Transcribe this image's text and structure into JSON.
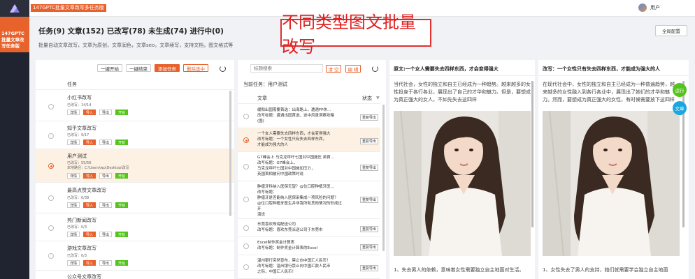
{
  "app": {
    "title": "147GPTC批量文章改写多任务版",
    "user_name": "用户"
  },
  "sidebar": {
    "items": [
      {
        "label": "147GPTC批量文章改写任务版"
      }
    ]
  },
  "summary": {
    "stats_line": "任务(9) 文章(152) 已改写(78) 未生成(74) 进行中(0)",
    "subtitle": "批量自动文章改写，文章为原创，文章润色，文章seo，文章续写，支持文档，图文格式等"
  },
  "banner": "不同类型图文批量改写",
  "global_config_label": "全局配置",
  "tasks_panel": {
    "buttons": {
      "start_all": "一键开始",
      "stop_all": "一键结束",
      "add_task": "添加任务",
      "delete_selected": "删除选中"
    },
    "column_header": "任务",
    "import_label": "导入",
    "export_label": "导出",
    "detail_label": "详情",
    "start_label": "开始",
    "rows": [
      {
        "name": "小红书改写",
        "done": "已改写：14/14"
      },
      {
        "name": "知乎文章改写",
        "done": "已改写：9/17"
      },
      {
        "name": "用户测试",
        "done": "已改写：55/56",
        "path": "本地路径：C:\\Users\\wp\\Desktop\\改写"
      },
      {
        "name": "最高点赞文章改写",
        "done": "已改写：0/38"
      },
      {
        "name": "热门新闻改写",
        "done": "已改写：0/3"
      },
      {
        "name": "游戏文章改写",
        "done": "已改写：0/3"
      },
      {
        "name": "公众号文章改写",
        "done": ""
      }
    ]
  },
  "articles_panel": {
    "search_placeholder": "标题搜索",
    "clear_label": "清 空",
    "edit_label": "编 辑",
    "current_task": "当前任务：用户测试",
    "col_article": "文章",
    "col_status": "状态",
    "regen_label": "重复导出",
    "rows": [
      {
        "text": "缓和出国需要首选：出海路上，遭遇FP休…\n改写标题：遭遇出国首选，途中风景洞察攻略\n(图)"
      },
      {
        "text": "一个女人需要失去四样东西，才会变得强大\n改写标题：一个女性只有失去四样东西，\n才能成为强大的人"
      },
      {
        "text": "G7峰会上 马克龙呼吁七国对中国施压 英首…\n改写标题：G7峰会上，\n马克龙呼吁七国对中国施加压力，\n英国首相被问中国政策时说"
      },
      {
        "text": "肿瘤牙科纳入医保无望？@位口腔种植牙医…\n改写标题：\n肿瘤牙是否能纳入医保采集成一项风险的问题？\n@位口腔种植牙医生并非我所有其他情况的形成过开\n演说"
      },
      {
        "text": "东莞喜欢珠海配送公司\n改写标题：喜欢东莞派送公司于东莞市"
      },
      {
        "text": "Excel制作奖金计算表\n改写标题：制作奖金计算表的Excel"
      },
      {
        "text": "温州银行突然宣布，禁止向中国汇人民币！\n改写标题：温州银行禁止向中国汇款人民币\n之际，中国汇人民币！"
      }
    ]
  },
  "original_panel": {
    "title": "原文:一个女人需要失去四样东西，才会变得强大",
    "para1": "当代社会，女性的独立和自主已经成为一种趋势。越来越多的女性投身于各行各业，展现出了自己的才华和魅力。但是，要想成为真正强大的女人，不如先失去这四样",
    "para2": "1、失去男人的依赖，意味着女性需要独立自主地面对生活。"
  },
  "rewrite_panel": {
    "title": "改写：一个女性只有失去四样东西，才能成为强大的人",
    "para1": "在现代社会中，女性的独立和自主已经成为一种普遍趋势，越来越多的女性融入到各行各业中，展现出了她们的才华和魅力。然而，要想成为真正强大的女性，有时候需要放下这四样",
    "para2": "1、女性失去了男人的支持，她们就需要学会独立自主地面"
  },
  "fab": {
    "run": "运行",
    "article": "文章"
  },
  "colors": {
    "accent": "#e8622c",
    "selected_row": "#fdf1e3",
    "banner_border": "#e03030",
    "fab_green": "#52c41a",
    "fab_blue": "#1aa7e0"
  }
}
